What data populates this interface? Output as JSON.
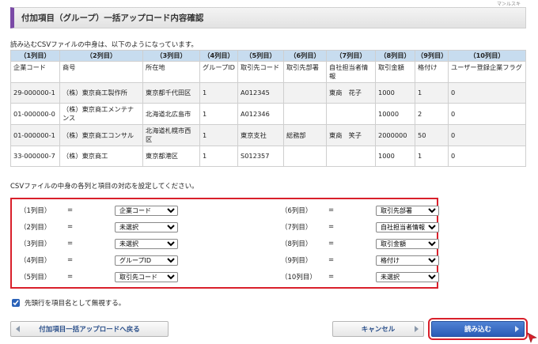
{
  "corner_text": "マ＞ルスキ",
  "page_title": "付加項目（グループ）一括アップロード内容確認",
  "intro_text": "読み込むCSVファイルの中身は、以下のようになっています。",
  "table": {
    "headers": [
      "（1列目）",
      "（2列目）",
      "（3列目）",
      "（4列目）",
      "（5列目）",
      "（6列目）",
      "（7列目）",
      "（8列目）",
      "（9列目）",
      "（10列目）"
    ],
    "column_names": [
      "企業コード",
      "商号",
      "所在地",
      "グループID",
      "取引先コード",
      "取引先部署",
      "自社担当者情報",
      "取引金額",
      "格付け",
      "ユーザー登録企業フラグ"
    ],
    "rows": [
      [
        "29-000000-1",
        "（株）東京商工製作所",
        "東京都千代田区",
        "1",
        "A012345",
        "",
        "東商　花子",
        "1000",
        "1",
        "0"
      ],
      [
        "01-000000-0",
        "（株）東京商工メンテナンス",
        "北海道北広島市",
        "1",
        "A012346",
        "",
        "",
        "10000",
        "2",
        "0"
      ],
      [
        "01-000000-1",
        "（株）東京商工コンサル",
        "北海道札幌市西区",
        "1",
        "東京支社",
        "総務部",
        "東商　笑子",
        "2000000",
        "50",
        "0"
      ],
      [
        "33-000000-7",
        "（株）東京商工",
        "東京都港区",
        "1",
        "S012357",
        "",
        "",
        "1000",
        "1",
        "0"
      ]
    ]
  },
  "setting_label": "CSVファイルの中身の各列と項目の対応を設定してください。",
  "mapping": {
    "equals": "=",
    "left": [
      {
        "label": "（1列目）",
        "value": "企業コード"
      },
      {
        "label": "（2列目）",
        "value": "未選択"
      },
      {
        "label": "（3列目）",
        "value": "未選択"
      },
      {
        "label": "（4列目）",
        "value": "グループID"
      },
      {
        "label": "（5列目）",
        "value": "取引先コード"
      }
    ],
    "right": [
      {
        "label": "（6列目）",
        "value": "取引先部署"
      },
      {
        "label": "（7列目）",
        "value": "自社担当者情報"
      },
      {
        "label": "（8列目）",
        "value": "取引金額"
      },
      {
        "label": "（9列目）",
        "value": "格付け"
      },
      {
        "label": "（10列目）",
        "value": "未選択"
      }
    ]
  },
  "checkbox": {
    "label": "先頭行を項目名として無視する。",
    "checked": true
  },
  "buttons": {
    "back": "付加項目一括アップロードへ戻る",
    "cancel": "キャンセル",
    "load": "読み込む"
  },
  "colors": {
    "accent_bar": "#7a4aa6",
    "header_bg": "#c7dcef",
    "highlight": "#d9202b",
    "primary_button": "#2a5cb6"
  }
}
